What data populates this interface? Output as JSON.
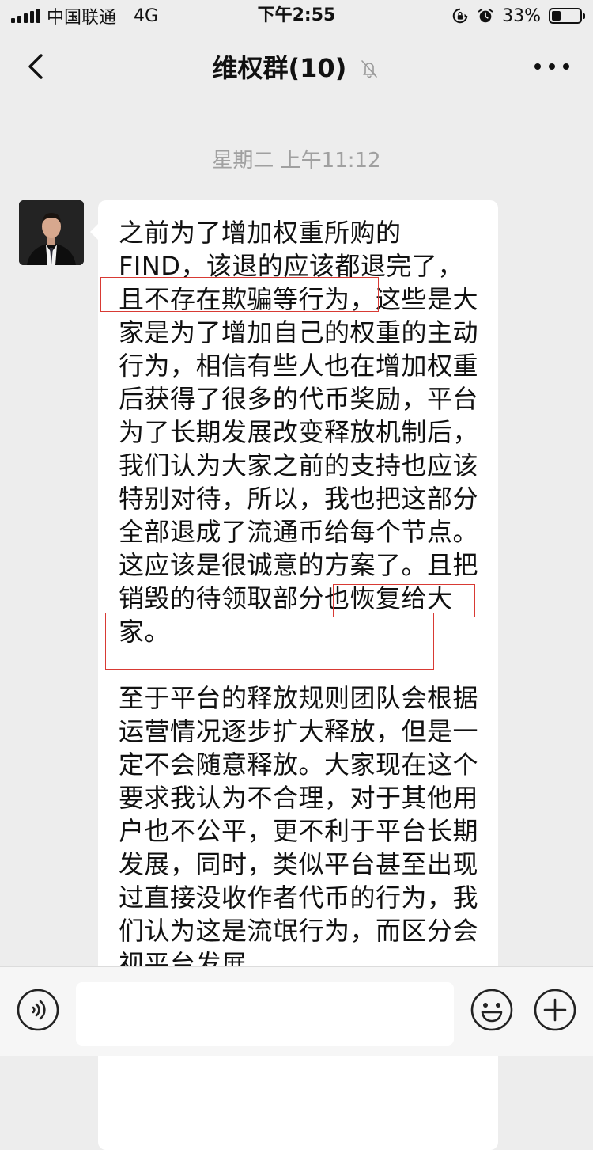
{
  "status_bar": {
    "carrier": "中国联通",
    "network": "4G",
    "time": "下午2:55",
    "battery_text": "33%",
    "battery_level": 0.33,
    "icons": [
      "signal-icon",
      "rotation-lock-icon",
      "alarm-icon",
      "battery-icon"
    ]
  },
  "nav": {
    "title": "维权群(10)",
    "icons": [
      "back-icon",
      "mute-icon",
      "more-icon"
    ]
  },
  "chat": {
    "timestamp": "星期二 上午11:12",
    "message": {
      "paragraph_1": "之前为了增加权重所购的FIND，该退的应该都退完了，且不存在欺骗等行为，这些是大家是为了增加自己的权重的主动行为，相信有些人也在增加权重后获得了很多的代币奖励，平台为了长期发展改变释放机制后，我们认为大家之前的支持也应该特别对待，所以，我也把这部分全部退成了流通币给每个节点。这应该是很诚意的方案了。且把销毁的待领取部分也恢复给大家。",
      "paragraph_2": "至于平台的释放规则团队会根据运营情况逐步扩大释放，但是一定不会随意释放。大家现在这个要求我认为不合理，对于其他用户也不公平，更不利于平台长期发展，同时，类似平台甚至出现过直接没收作者代币的行为，我们认为这是流氓行为，而区分会视平台发展"
    }
  },
  "input_bar": {
    "placeholder": "",
    "icons": [
      "voice-icon",
      "emoji-icon",
      "plus-icon"
    ]
  },
  "colors": {
    "background": "#ededed",
    "bubble": "#ffffff",
    "highlight_box": "#d83a34",
    "timestamp": "#a0a0a0"
  }
}
